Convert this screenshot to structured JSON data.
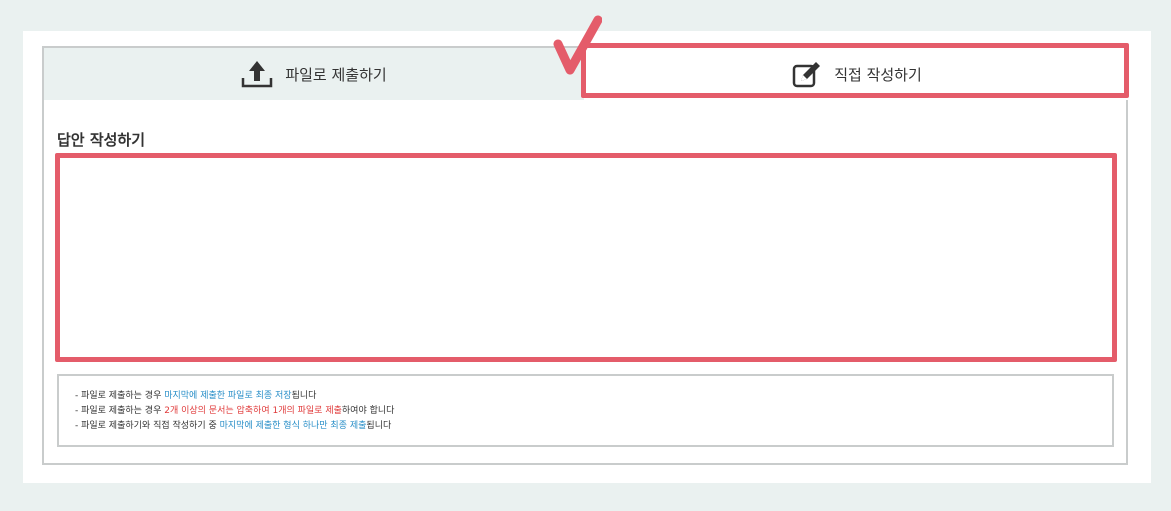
{
  "tabs": {
    "file_label": "파일로 제출하기",
    "direct_label": "직접 작성하기"
  },
  "answer": {
    "title": "답안 작성하기",
    "value": ""
  },
  "notice": {
    "line1": {
      "pre": "- 파일로 제출하는 경우 ",
      "highlight": "마지막에 제출한 파일로 최종 저장",
      "post": "됩니다"
    },
    "line2": {
      "pre": "- 파일로 제출하는 경우 ",
      "highlight": "2개 이상의 문서는 압축하여 1개의 파일로 제출",
      "post": "하여야 합니다"
    },
    "line3": {
      "pre": "- 파일로 제출하기와 직접 작성하기 중 ",
      "highlight": "마지막에 제출한 형식 하나만 최종 제출",
      "post": "됩니다"
    }
  },
  "colors": {
    "highlight_box": "#e45c6a",
    "info_blue": "#2a8fc8",
    "info_red": "#e03a3a",
    "tab_bg": "#eaf1f0"
  },
  "icons": [
    "upload-icon",
    "pencil-edit-icon",
    "checkmark-icon"
  ]
}
